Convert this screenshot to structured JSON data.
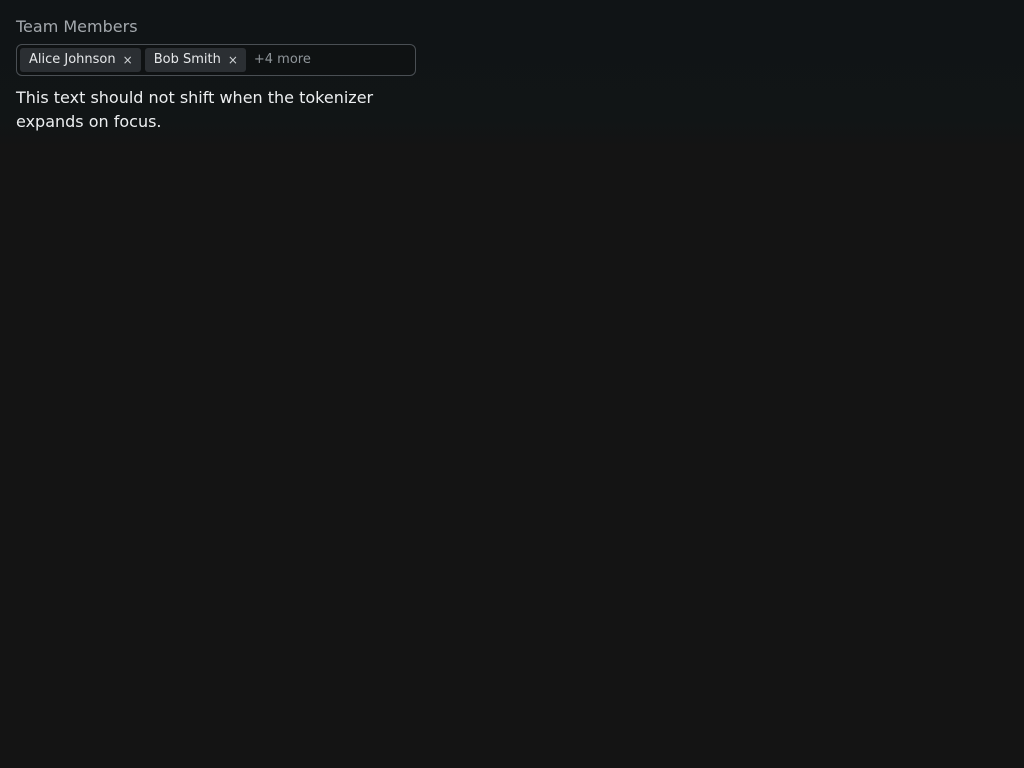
{
  "field": {
    "label": "Team Members",
    "tokens": [
      {
        "label": "Alice Johnson",
        "remove_glyph": "×"
      },
      {
        "label": "Bob Smith",
        "remove_glyph": "×"
      }
    ],
    "overflow_text": "+4 more",
    "input_value": ""
  },
  "note": {
    "text": "This text should not shift when the tokenizer expands on focus."
  },
  "colors": {
    "background": "#141414",
    "token_bg": "#2b2f33",
    "border": "#4a4f54",
    "label_text": "#a3a8ad",
    "muted_text": "#8f959a"
  }
}
